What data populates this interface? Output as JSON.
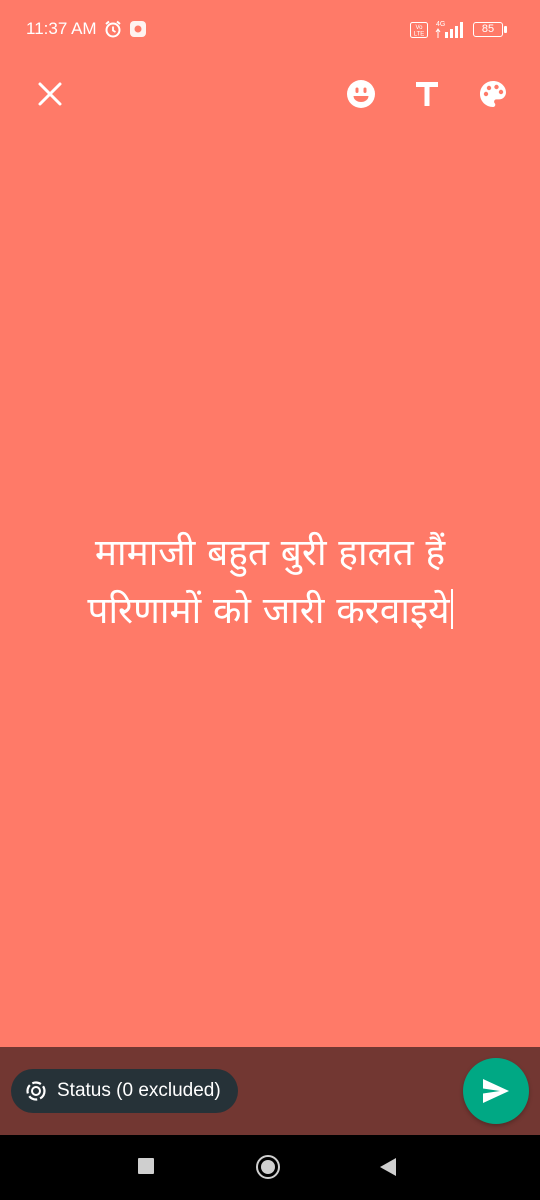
{
  "statusbar": {
    "time": "11:37 AM",
    "network": "4G",
    "volte": "Vo LTE",
    "battery": "85"
  },
  "toolbar": {
    "close_icon": "close-icon",
    "emoji_icon": "emoji-icon",
    "text_icon": "text-format-icon",
    "palette_icon": "palette-icon"
  },
  "status": {
    "line1": "मामाजी बहुत बुरी हालत हैं",
    "line2": "परिणामों को जारी करवाइये",
    "background_color": "#FF7A68"
  },
  "bottom": {
    "audience_label": "Status (0 excluded)",
    "send_icon": "send-icon",
    "send_color": "#00A884"
  },
  "navbar": {
    "recent_icon": "recent-apps-icon",
    "home_icon": "home-icon",
    "back_icon": "back-icon"
  }
}
